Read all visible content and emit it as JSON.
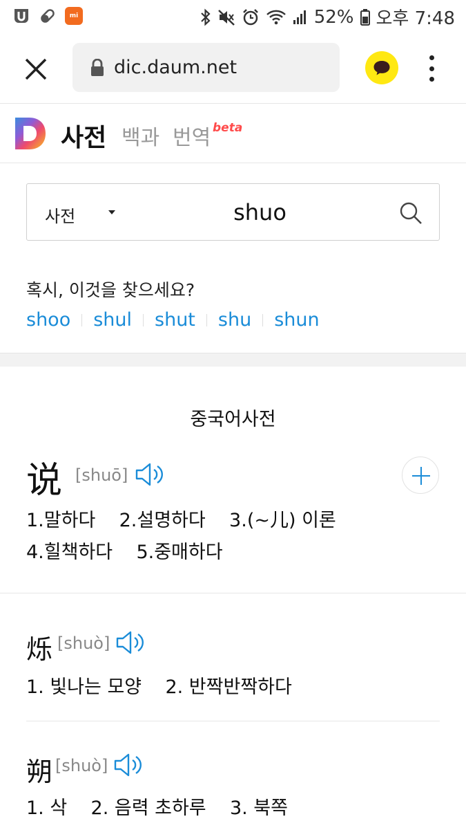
{
  "status_bar": {
    "battery": "52%",
    "time": "오후 7:48",
    "mi_label": "mi",
    "icons": [
      "notification-u-icon",
      "pill-icon",
      "mi-app-icon",
      "bluetooth-icon",
      "mute-icon",
      "alarm-icon",
      "wifi-icon",
      "signal-icon",
      "battery-icon"
    ]
  },
  "browser": {
    "url": "dic.daum.net"
  },
  "daum_header": {
    "nav_dict": "사전",
    "nav_baek": "백과",
    "nav_trans": "번역",
    "beta": "beta"
  },
  "search": {
    "category": "사전",
    "query": "shuo"
  },
  "suggestion": {
    "question": "혹시, 이것을 찾으세요?",
    "items": [
      "shoo",
      "shul",
      "shut",
      "shu",
      "shun"
    ]
  },
  "section": {
    "title": "중국어사전"
  },
  "entries": [
    {
      "char": "说",
      "pinyin": "[shuō]",
      "lines": [
        "1.말하다    2.설명하다    3.(~儿) 이론",
        "4.힐책하다    5.중매하다"
      ]
    },
    {
      "char": "烁",
      "pinyin": "[shuò]",
      "lines": [
        "1. 빛나는 모양    2. 반짝반짝하다"
      ]
    },
    {
      "char": "朔",
      "pinyin": "[shuò]",
      "lines": [
        "1. 삭    2. 음력 초하루    3. 북쪽"
      ]
    }
  ],
  "colors": {
    "link": "#1a8cd8",
    "kakao": "#ffe812",
    "highlight": "#f3ea19",
    "beta": "#ff4b4b"
  }
}
